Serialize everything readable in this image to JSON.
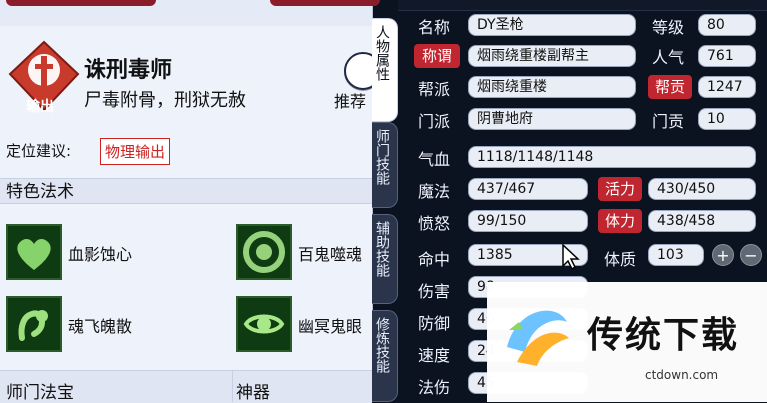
{
  "left": {
    "school_title": "诛刑毒师",
    "school_desc": "尸毒附骨，刑狱无赦",
    "badge_text": "输出",
    "recommend": "推荐",
    "position_label": "定位建议:",
    "position_value": "物理输出",
    "skills_title": "特色法术",
    "skills": [
      {
        "name": "血影蚀心",
        "icon": "heart-skill-icon"
      },
      {
        "name": "百鬼噬魂",
        "icon": "spiral-skill-icon"
      },
      {
        "name": "魂飞魄散",
        "icon": "hands-skill-icon"
      },
      {
        "name": "幽冥鬼眼",
        "icon": "eye-skill-icon"
      }
    ],
    "bottom_left": "师门法宝",
    "bottom_mid": "神器"
  },
  "tabs": [
    {
      "label": "人物属性"
    },
    {
      "label": "师门技能"
    },
    {
      "label": "辅助技能"
    },
    {
      "label": "修炼技能"
    }
  ],
  "right": {
    "name_label": "名称",
    "name_value": "DY圣枪",
    "level_label": "等级",
    "level_value": "80",
    "title_label": "称谓",
    "title_value": "烟雨绕重楼副帮主",
    "pop_label": "人气",
    "pop_value": "761",
    "faction_label": "帮派",
    "faction_value": "烟雨绕重楼",
    "contrib_label": "帮贡",
    "contrib_value": "1247",
    "sect_label": "门派",
    "sect_value": "阴曹地府",
    "sect_contrib_label": "门贡",
    "sect_contrib_value": "10",
    "hp_label": "气血",
    "hp_value": "1118/1148/1148",
    "mp_label": "魔法",
    "mp_value": "437/467",
    "vitality_label": "活力",
    "vitality_value": "430/450",
    "anger_label": "愤怒",
    "anger_value": "99/150",
    "stamina_label": "体力",
    "stamina_value": "438/458",
    "hit_label": "命中",
    "hit_value": "1385",
    "con_label": "体质",
    "con_value": "103",
    "dmg_label": "伤害",
    "dmg_value": "98",
    "def_label": "防御",
    "def_value": "46",
    "speed_label": "速度",
    "speed_value": "24",
    "mdmg_label": "法伤",
    "mdmg_value": "45",
    "plus": "+",
    "minus": "−"
  },
  "watermark": {
    "title": "传统下载",
    "domain": "ctdown.com"
  },
  "colors": {
    "accent_red": "#c0262f",
    "dark_bg": "#0b1220",
    "panel_light": "#eef2fb"
  }
}
